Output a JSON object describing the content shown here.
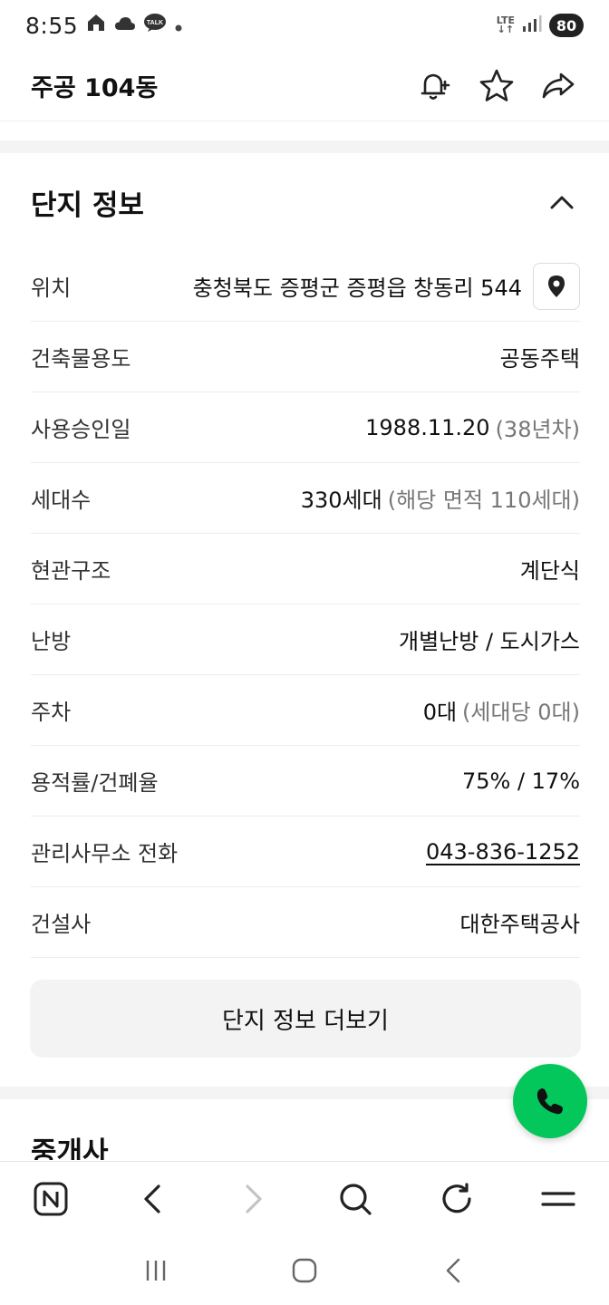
{
  "status_bar": {
    "time": "8:55",
    "network": "LTE",
    "battery": "80"
  },
  "header": {
    "title": "주공 104동",
    "icons": [
      "bell-plus-icon",
      "star-icon",
      "share-icon"
    ]
  },
  "complex_info": {
    "heading": "단지 정보",
    "rows": [
      {
        "label": "위치",
        "value": "충청북도 증평군 증평읍 창동리 544",
        "sub": ""
      },
      {
        "label": "건축물용도",
        "value": "공동주택",
        "sub": ""
      },
      {
        "label": "사용승인일",
        "value": "1988.11.20",
        "sub": "(38년차)"
      },
      {
        "label": "세대수",
        "value": "330세대",
        "sub": "(해당 면적 110세대)"
      },
      {
        "label": "현관구조",
        "value": "계단식",
        "sub": ""
      },
      {
        "label": "난방",
        "value": "개별난방 / 도시가스",
        "sub": ""
      },
      {
        "label": "주차",
        "value": "0대",
        "sub": "(세대당 0대)"
      },
      {
        "label": "용적률/건폐율",
        "value": "75% / 17%",
        "sub": ""
      },
      {
        "label": "관리사무소 전화",
        "value": "043-836-1252",
        "sub": ""
      },
      {
        "label": "건설사",
        "value": "대한주택공사",
        "sub": ""
      }
    ],
    "more_button": "단지 정보 더보기"
  },
  "broker_section": {
    "heading": "중개사"
  },
  "colors": {
    "accent_green": "#03c75a",
    "text_primary": "#111111",
    "text_secondary": "#777777"
  }
}
